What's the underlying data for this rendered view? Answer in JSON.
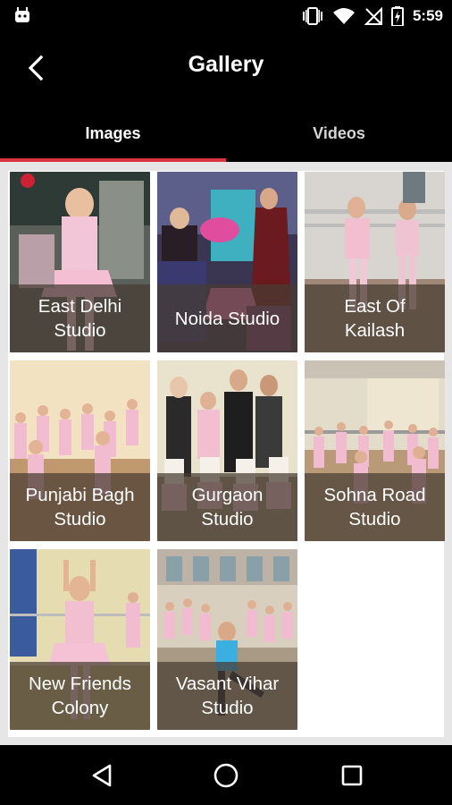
{
  "status_bar": {
    "time": "5:59",
    "icons": [
      "android-icon",
      "vibrate-icon",
      "wifi-icon",
      "no-signal-icon",
      "battery-charging-icon"
    ]
  },
  "app_bar": {
    "title": "Gallery",
    "back_icon": "back-arrow-icon"
  },
  "tabs": [
    {
      "label": "Images",
      "active": true
    },
    {
      "label": "Videos",
      "active": false
    }
  ],
  "accent_color": "#d9343f",
  "gallery": {
    "items": [
      {
        "label": "East Delhi\nStudio"
      },
      {
        "label": "Noida Studio"
      },
      {
        "label": "East Of\nKailash"
      },
      {
        "label": "Punjabi Bagh\nStudio"
      },
      {
        "label": "Gurgaon\nStudio"
      },
      {
        "label": "Sohna Road\nStudio"
      },
      {
        "label": "New Friends\nColony"
      },
      {
        "label": "Vasant Vihar\nStudio"
      }
    ]
  },
  "nav_bar": {
    "icons": [
      "back-triangle-icon",
      "home-circle-icon",
      "recents-square-icon"
    ]
  }
}
